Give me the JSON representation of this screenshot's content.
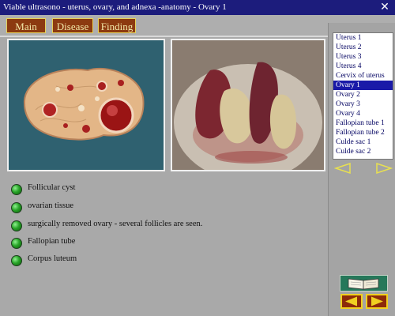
{
  "window": {
    "title": "Viable ultrasono - uterus, ovary, and adnexa -anatomy - Ovary 1",
    "close_glyph": "✕"
  },
  "nav_tabs": [
    {
      "label": "Main"
    },
    {
      "label": "Disease"
    },
    {
      "label": "Finding"
    }
  ],
  "list": {
    "items": [
      "Uterus 1",
      "Uterus 2",
      "Uterus 3",
      "Uterus 4",
      "Cervix of uterus",
      "Ovary 1",
      "Ovary 2",
      "Ovary 3",
      "Ovary 4",
      "Fallopian tube 1",
      "Fallopian tube 2",
      "Culde sac 1",
      "Culde sac 2"
    ],
    "selected": "Ovary 1"
  },
  "findings": [
    "Follicular cyst",
    "ovarian tissue",
    "surgically removed ovary - several follicles are seen.",
    "Fallopian tube",
    "Corpus luteum"
  ],
  "icons": {
    "list_scroll_left": "triangle-left-outline-icon",
    "list_scroll_right": "triangle-right-outline-icon",
    "book": "open-book-icon",
    "prev": "triangle-left-icon",
    "next": "triangle-right-icon"
  },
  "colors": {
    "title_bar": "#1c1c7c",
    "tab_bg": "#8c3a10",
    "tab_text": "#f2e8a8",
    "selected_item": "#1a1aa8",
    "bullet": "#28a428",
    "nav_button": "#8c2a0a",
    "nav_border": "#f0d020"
  }
}
